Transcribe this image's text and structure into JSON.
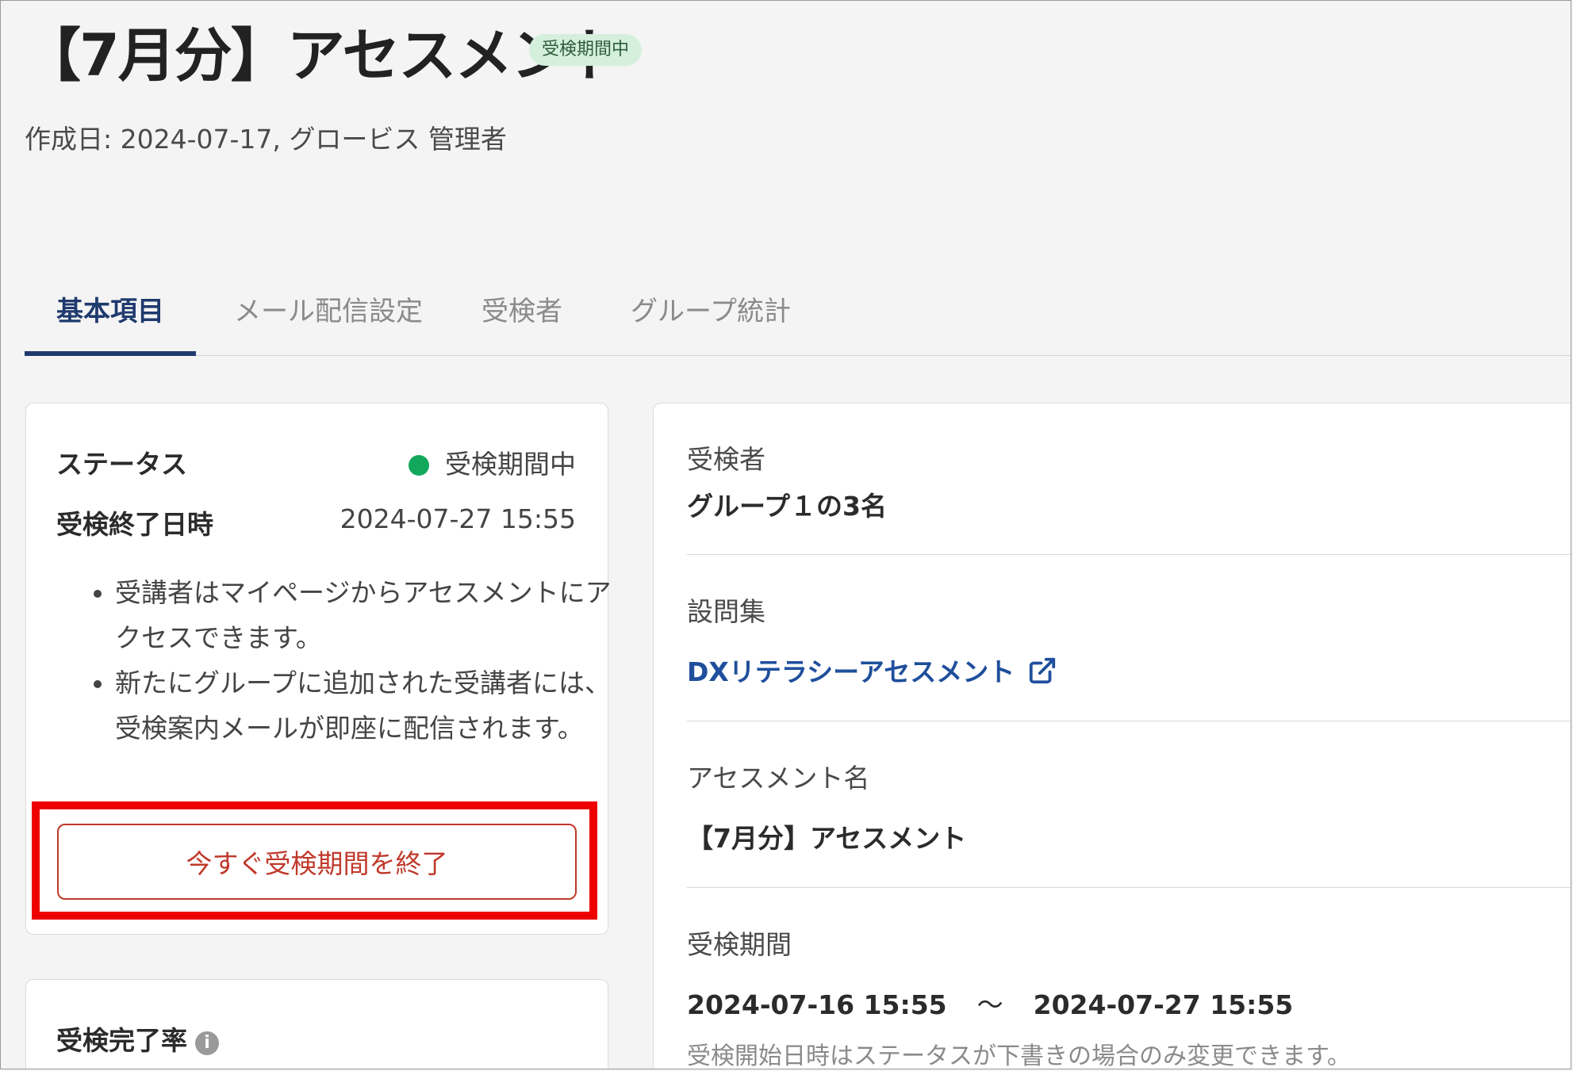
{
  "header": {
    "title": "【7月分】アセスメント",
    "status_chip": "受検期間中",
    "meta": "作成日: 2024-07-17, グロービス 管理者"
  },
  "tabs": [
    {
      "label": "基本項目",
      "active": true
    },
    {
      "label": "メール配信設定",
      "active": false
    },
    {
      "label": "受検者",
      "active": false
    },
    {
      "label": "グループ統計",
      "active": false
    }
  ],
  "status_card": {
    "status_label": "ステータス",
    "status_value": "受検期間中",
    "end_label": "受検終了日時",
    "end_value": "2024-07-27 15:55",
    "notes": [
      "受講者はマイページからアセスメントにアクセスできます。",
      "新たにグループに追加された受講者には、受検案内メールが即座に配信されます。"
    ],
    "end_button": "今すぐ受検期間を終了"
  },
  "completion_card": {
    "label": "受検完了率"
  },
  "details": {
    "examinees_label": "受検者",
    "examinees_value": "グループ１の3名",
    "question_set_label": "設問集",
    "question_set_link": "DXリテラシーアセスメント",
    "assessment_name_label": "アセスメント名",
    "assessment_name_value": "【7月分】アセスメント",
    "period_label": "受検期間",
    "period_start": "2024-07-16 15:55",
    "period_separator": "〜",
    "period_end": "2024-07-27 15:55",
    "period_hint": "受検開始日時はステータスが下書きの場合のみ変更できます。"
  },
  "colors": {
    "accent": "#1f3a6e",
    "status_green": "#12a85c",
    "danger": "#c0392b",
    "highlight_red": "#ee0000"
  }
}
